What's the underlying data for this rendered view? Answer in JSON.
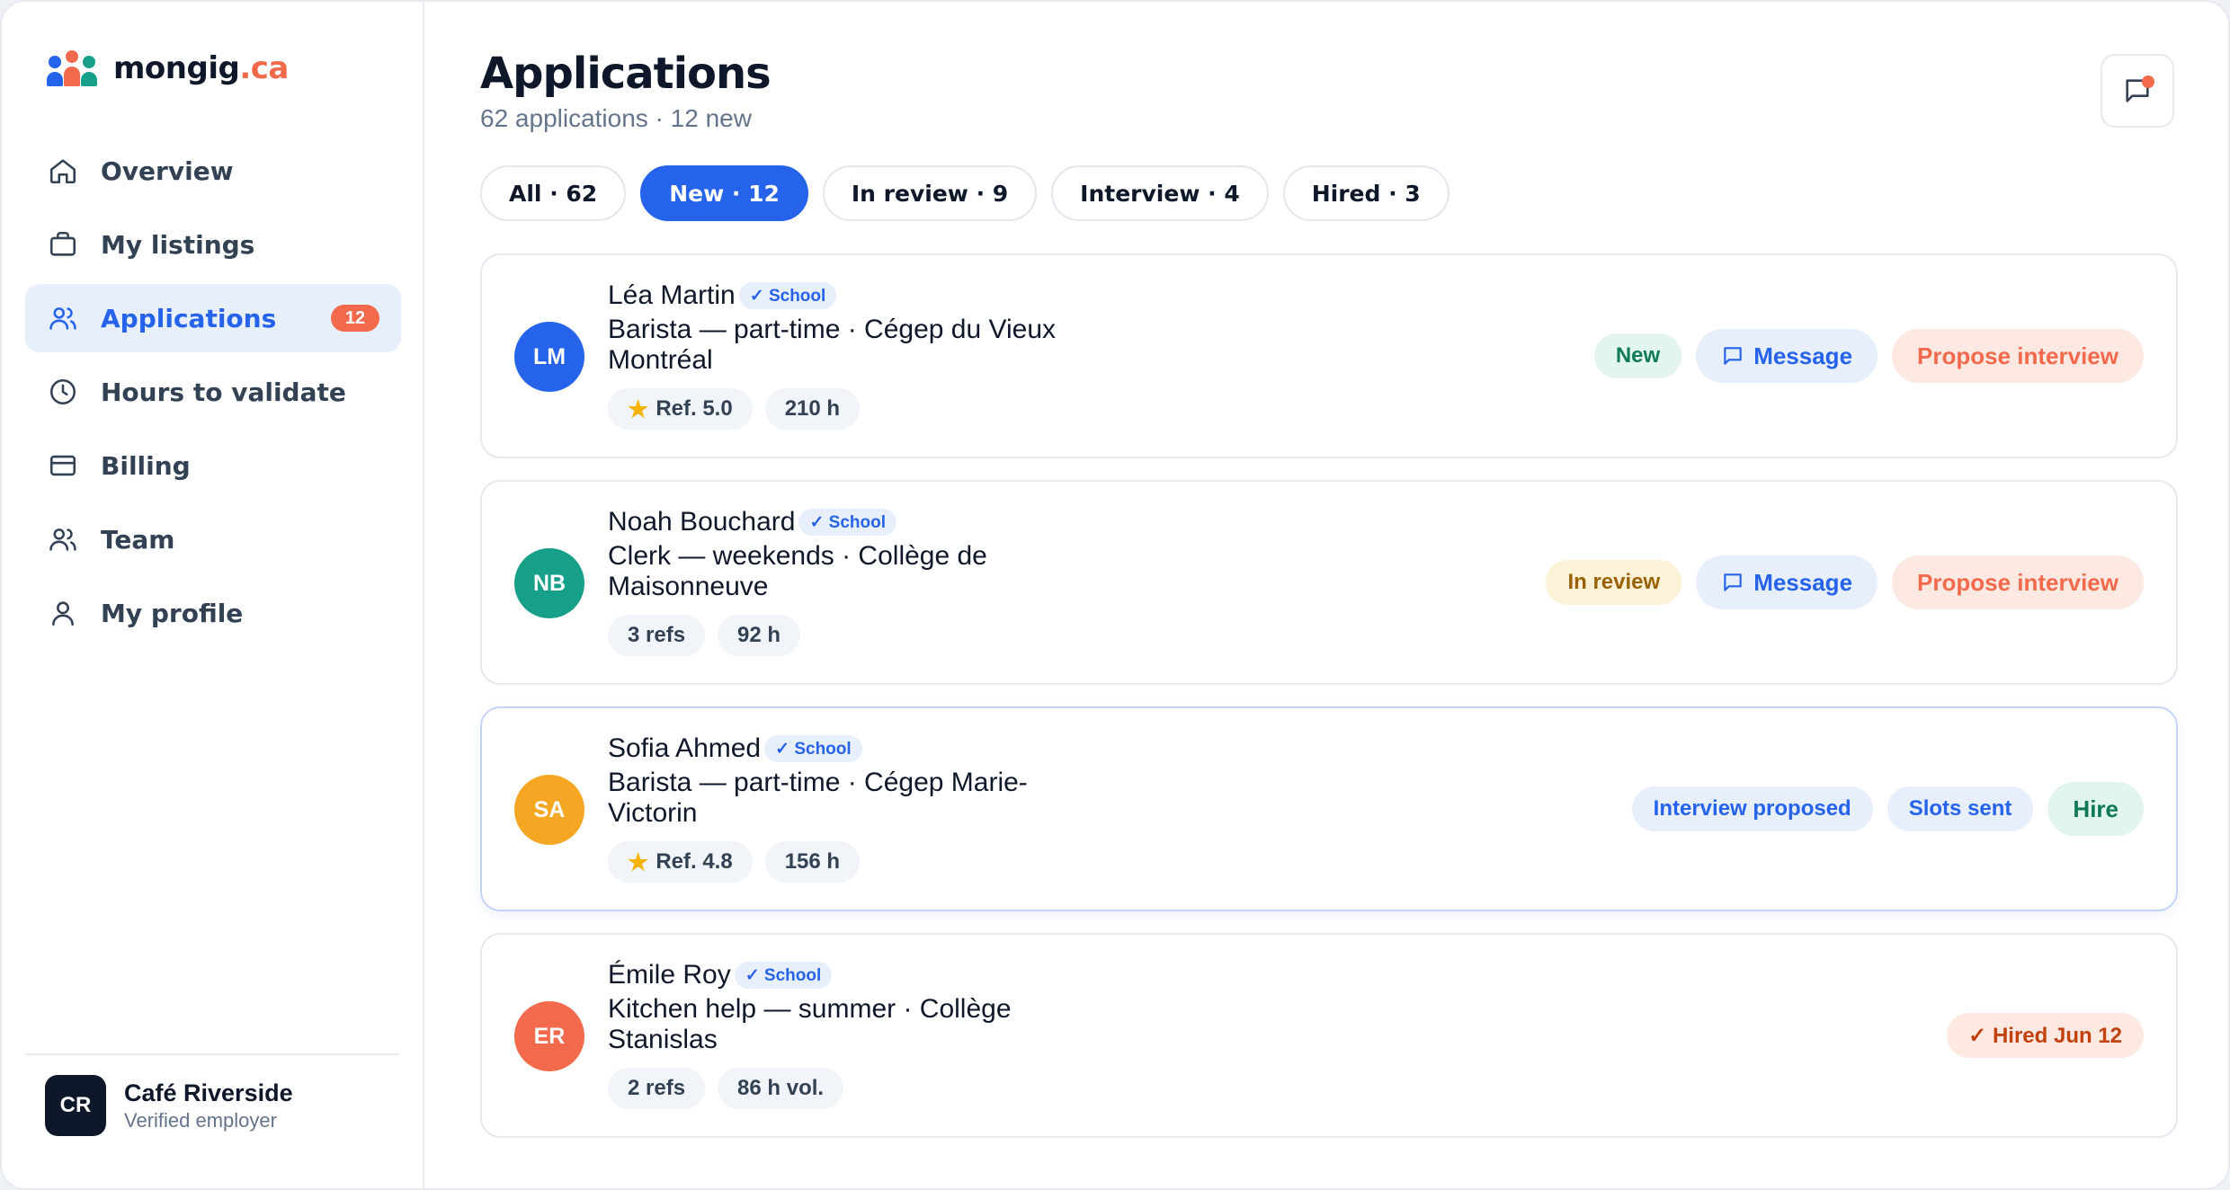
{
  "brand": {
    "name": "mongig",
    "tld": ".ca"
  },
  "sidebar": {
    "items": [
      {
        "label": "Overview",
        "icon": "home-icon"
      },
      {
        "label": "My listings",
        "icon": "briefcase-icon"
      },
      {
        "label": "Applications",
        "icon": "users-icon",
        "badge": "12",
        "active": true
      },
      {
        "label": "Hours to validate",
        "icon": "clock-icon"
      },
      {
        "label": "Billing",
        "icon": "credit-card-icon"
      },
      {
        "label": "Team",
        "icon": "team-icon"
      },
      {
        "label": "My profile",
        "icon": "user-icon"
      }
    ],
    "employer": {
      "initials": "CR",
      "name": "Café Riverside",
      "status": "Verified employer"
    }
  },
  "header": {
    "title": "Applications",
    "subtitle": "62 applications · 12 new"
  },
  "filters": [
    {
      "label": "All · 62"
    },
    {
      "label": "New · 12",
      "active": true
    },
    {
      "label": "In review · 9"
    },
    {
      "label": "Interview · 4"
    },
    {
      "label": "Hired · 3"
    }
  ],
  "applications": [
    {
      "initials": "LM",
      "color": "#2563eb",
      "name": "Léa Martin",
      "school_badge": "✓ School",
      "role": "Barista — part-time · Cégep du Vieux Montréal",
      "stats": [
        "Ref. 5.0",
        "210 h"
      ],
      "stat_star": [
        true,
        false
      ],
      "status": "New",
      "message": "Message",
      "propose": "Propose interview"
    },
    {
      "initials": "NB",
      "color": "#16a08a",
      "name": "Noah Bouchard",
      "school_badge": "✓ School",
      "role": "Clerk — weekends · Collège de Maisonneuve",
      "stats": [
        "3 refs",
        "92 h"
      ],
      "status": "In review",
      "message": "Message",
      "propose": "Propose interview"
    },
    {
      "initials": "SA",
      "color": "#f5a623",
      "name": "Sofia Ahmed",
      "school_badge": "✓ School",
      "role": "Barista — part-time · Cégep Marie-Victorin",
      "stats": [
        "Ref. 4.8",
        "156 h"
      ],
      "tag1": "Interview proposed",
      "tag2": "Slots sent",
      "hire": "Hire"
    },
    {
      "initials": "ER",
      "color": "#f26a4b",
      "name": "Émile Roy",
      "school_badge": "✓ School",
      "role": "Kitchen help — summer · Collège Stanislas",
      "stats": [
        "2 refs",
        "86 h vol."
      ],
      "hired": "✓ Hired Jun 12"
    }
  ]
}
